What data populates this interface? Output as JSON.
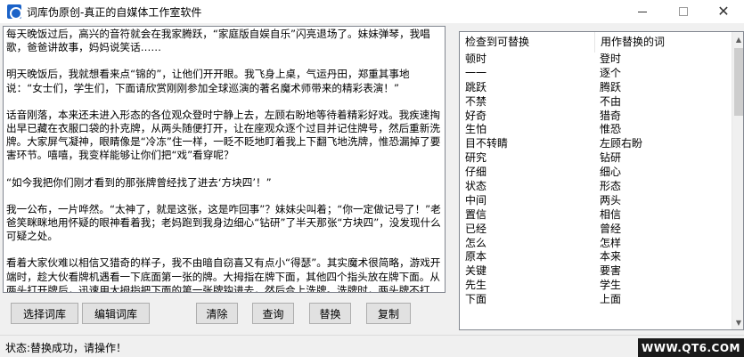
{
  "window": {
    "title": "词库伪原创-真正的自媒体工作室软件",
    "minimize_glyph": "",
    "maximize_glyph": "",
    "close_glyph": "✕"
  },
  "main_text": {
    "paragraphs": [
      "每天晚饭过后，高兴的音符就会在我家腾跃，“家庭版自娱自乐”闪亮退场了。妹妹弹琴，我唱歌，爸爸讲故事，妈妈说笑话……",
      "明天晚饭后，我就想看来点“锦的”，让他们开开眼。我飞身上桌，气运丹田，郑重其事地说：“女士们，学生们，下面请欣赏刚刚参加全球巡演的著名魔术师带来的精彩表演！”",
      "话音刚落，本来还未进入形态的各位观众登时宁静上去，左顾右盼地等待着精彩好戏。我疾速掏出早已藏在衣服口袋的扑克牌，从两头随便打开，让在座观众逐个过目并记住牌号，然后重新洗牌。大家屏气凝神，眼睛像是“冷冻”住一样，一眨不眨地盯着我上下翻飞地洗牌，惟恐漏掉了要害环节。嘻嘻，我变样能够让你们把“戏”看穿呢？",
      "“如今我把你们刚才看到的那张牌曾经找了进去‘方块四’！”",
      "我一公布，一片哗然。“太神了，就是这张，这是咋回事”？妹妹尖叫着；“你一定做记号了！”老爸笑眯眯地用怀疑的眼神看着我；老妈跑到我身边细心“钻研”了半天那张“方块四”，没发现什么可疑之处。",
      "看着大家伙难以相信又猎奇的样子，我不由暗自窃喜又有点小“得瑟”。其实魔术很简略，游戏开端时，趁大伙看牌机遇看一下底面第一张的牌。大拇指在牌下面，其他四个指头放在牌下面。从两头打开牌后，迅速用大拇指把下面的第一张牌钩进去，然后合上洗牌。洗牌时，两头牌不打乱，第一张牌前面的那一张就是了。"
    ]
  },
  "buttons": {
    "select_lib": "选择词库",
    "edit_lib": "编辑词库",
    "clear": "清除",
    "query": "查询",
    "replace": "替换",
    "copy": "复制"
  },
  "wordlist": {
    "columns": [
      "检查到可替换",
      "用作替换的词"
    ],
    "rows": [
      [
        "顿时",
        "登时"
      ],
      [
        "一一",
        "逐个"
      ],
      [
        "跳跃",
        "腾跃"
      ],
      [
        "不禁",
        "不由"
      ],
      [
        "好奇",
        "猎奇"
      ],
      [
        "生怕",
        "惟恐"
      ],
      [
        "目不转睛",
        "左顾右盼"
      ],
      [
        "研究",
        "钻研"
      ],
      [
        "仔细",
        "细心"
      ],
      [
        "状态",
        "形态"
      ],
      [
        "中间",
        "两头"
      ],
      [
        "置信",
        "相信"
      ],
      [
        "已经",
        "曾经"
      ],
      [
        "怎么",
        "怎样"
      ],
      [
        "原本",
        "本来"
      ],
      [
        "关键",
        "要害"
      ],
      [
        "先生",
        "学生"
      ],
      [
        "下面",
        "上面"
      ]
    ]
  },
  "status": {
    "text": "状态:替换成功，请操作！"
  },
  "watermark": {
    "text": "WWW.QT6.COM"
  },
  "colors": {
    "accent_icon": "#1a62c8",
    "border": "#828790",
    "button_face": "#e1e1e1"
  }
}
